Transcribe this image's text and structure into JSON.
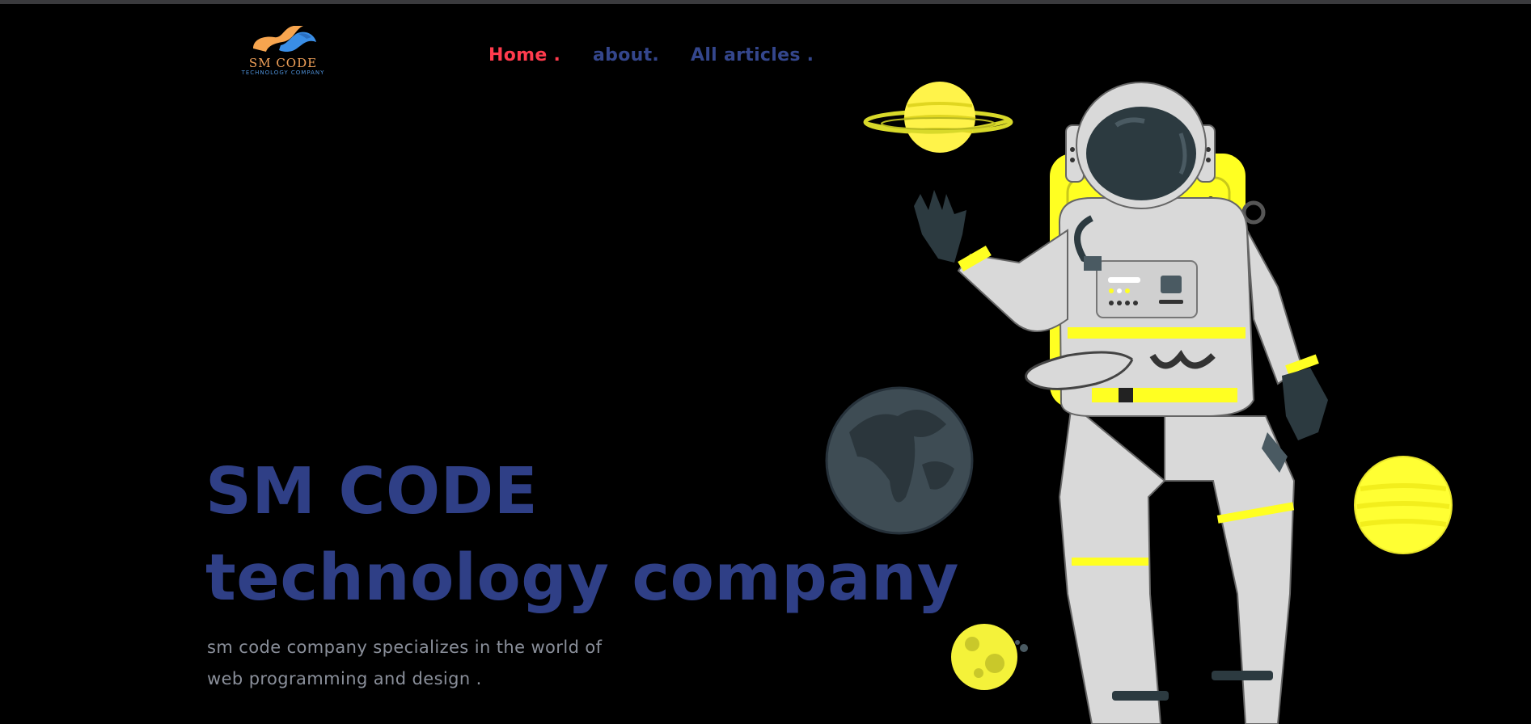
{
  "brand": {
    "name": "SM CODE",
    "tagline": "TECHNOLOGY COMPANY",
    "colors": {
      "orange": "#f7a54f",
      "blue": "#3a8ee6"
    }
  },
  "nav": {
    "items": [
      {
        "label": "Home .",
        "active": true
      },
      {
        "label": "about.",
        "active": false
      },
      {
        "label": "All articles .",
        "active": false
      }
    ]
  },
  "hero": {
    "title_line1": "SM CODE",
    "title_line2": "technology company",
    "description_line1": "sm code company specializes in the world of",
    "description_line2": "web programming and design ."
  },
  "theme": {
    "background": "#000000",
    "accent": "#ff3b4d",
    "primary": "#2f3f86",
    "muted_text": "#8a8f9a",
    "yellow": "#ffff33"
  },
  "illustration": {
    "icons": [
      "astronaut-icon",
      "ringed-planet-icon",
      "earth-icon",
      "yellow-planet-icon",
      "moon-icon"
    ]
  }
}
